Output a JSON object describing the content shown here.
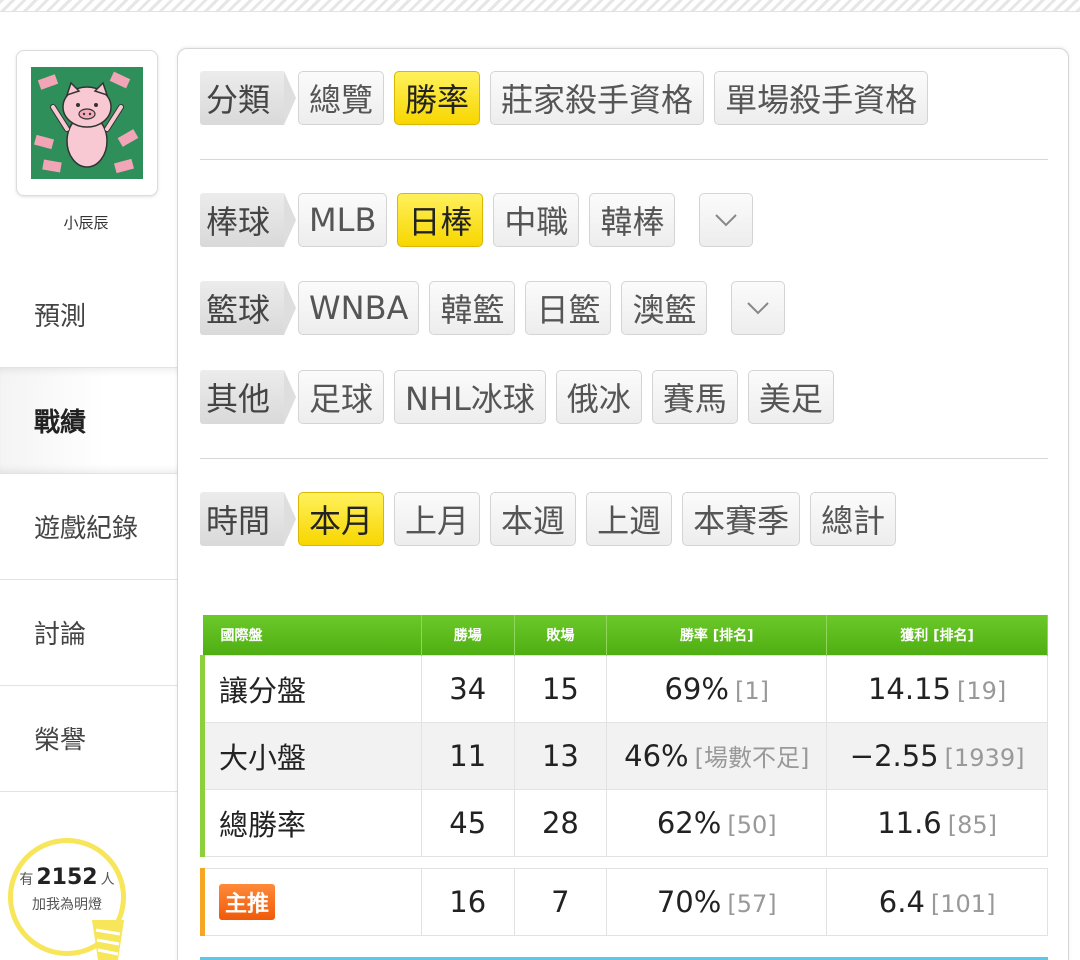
{
  "user": {
    "name": "小辰辰",
    "avatar_icon": "pig-avatar-icon"
  },
  "nav": {
    "items": [
      {
        "label": "預測",
        "active": false
      },
      {
        "label": "戰績",
        "active": true
      },
      {
        "label": "遊戲紀錄",
        "active": false
      },
      {
        "label": "討論",
        "active": false
      },
      {
        "label": "榮譽",
        "active": false
      }
    ]
  },
  "fans": {
    "prefix": "有",
    "count": "2152",
    "suffix": "人",
    "line2": "加我為明燈"
  },
  "filters": {
    "category": {
      "label": "分類",
      "options": [
        "總覽",
        "勝率",
        "莊家殺手資格",
        "單場殺手資格"
      ],
      "selected": "勝率"
    },
    "baseball": {
      "label": "棒球",
      "options": [
        "MLB",
        "日棒",
        "中職",
        "韓棒"
      ],
      "selected": "日棒"
    },
    "basketball": {
      "label": "籃球",
      "options": [
        "WNBA",
        "韓籃",
        "日籃",
        "澳籃"
      ],
      "selected": ""
    },
    "other": {
      "label": "其他",
      "options": [
        "足球",
        "NHL冰球",
        "俄冰",
        "賽馬",
        "美足"
      ],
      "selected": ""
    },
    "time": {
      "label": "時間",
      "options": [
        "本月",
        "上月",
        "本週",
        "上週",
        "本賽季",
        "總計"
      ],
      "selected": "本月"
    }
  },
  "table": {
    "headers": {
      "market": "國際盤",
      "wins": "勝場",
      "losses": "敗場",
      "win_rate": "勝率 [排名]",
      "profit": "獲利 [排名]"
    },
    "rows": [
      {
        "name": "讓分盤",
        "wins": "34",
        "losses": "15",
        "rate": "69%",
        "rate_rank": "[1]",
        "profit": "14.15",
        "profit_rank": "[19]"
      },
      {
        "name": "大小盤",
        "wins": "11",
        "losses": "13",
        "rate": "46%",
        "rate_rank": "[場數不足]",
        "profit": "−2.55",
        "profit_rank": "[1939]"
      },
      {
        "name": "總勝率",
        "wins": "45",
        "losses": "28",
        "rate": "62%",
        "rate_rank": "[50]",
        "profit": "11.6",
        "profit_rank": "[85]"
      }
    ],
    "featured": {
      "badge": "主推",
      "wins": "16",
      "losses": "7",
      "rate": "70%",
      "rate_rank": "[57]",
      "profit": "6.4",
      "profit_rank": "[101]"
    }
  },
  "colors": {
    "selected_chip": "#f7d600",
    "header_green": "#5cb81c",
    "badge_orange": "#f05a08"
  }
}
